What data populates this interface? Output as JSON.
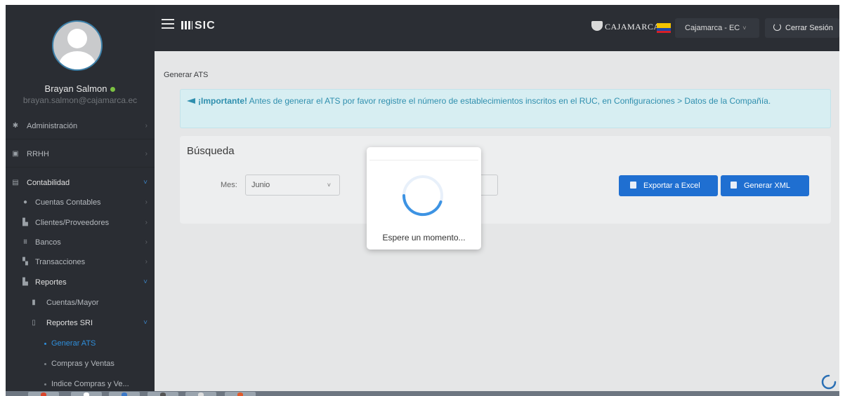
{
  "user": {
    "name": "Brayan Salmon",
    "email": "brayan.salmon@cajamarca.ec"
  },
  "menu": {
    "administracion": "Administración",
    "rrhh": "RRHH",
    "contabilidad": "Contabilidad",
    "cuentas_contables": "Cuentas Contables",
    "clientes_proveedores": "Clientes/Proveedores",
    "bancos": "Bancos",
    "transacciones": "Transacciones",
    "reportes": "Reportes",
    "cuentas_mayor": "Cuentas/Mayor",
    "reportes_sri": "Reportes SRI",
    "generar_ats": "Generar ATS",
    "compras_ventas": "Compras y Ventas",
    "indice_compras": "Indice Compras y Ve..."
  },
  "topbar": {
    "logo": "SIC",
    "brand": "CAJAMARCA",
    "company": "Cajamarca - EC",
    "logout": "Cerrar Sesión"
  },
  "page": {
    "breadcrumb": "Generar ATS",
    "alert_strong": "¡Importante!",
    "alert_text": " Antes de generar el ATS por favor registre el número de establecimientos inscritos en el RUC, en Configuraciones > Datos de la Compañía."
  },
  "search": {
    "title": "Búsqueda",
    "mes_label": "Mes:",
    "mes_value": "Junio",
    "export_excel": "Exportar a Excel",
    "generar_xml": "Generar XML"
  },
  "modal": {
    "text": "Espere un momento..."
  },
  "colors": {
    "primary": "#1f6fd1",
    "sidebar": "#2a2d33",
    "topbar": "#2b2e34",
    "active_link": "#2f8fdc",
    "alert_bg": "#d7eef2",
    "online": "#7cc242"
  },
  "icons": {
    "hamburger": "menu-icon",
    "logout": "power-icon",
    "alert": "megaphone-icon",
    "excel": "file-excel-icon",
    "xml": "file-code-icon"
  }
}
